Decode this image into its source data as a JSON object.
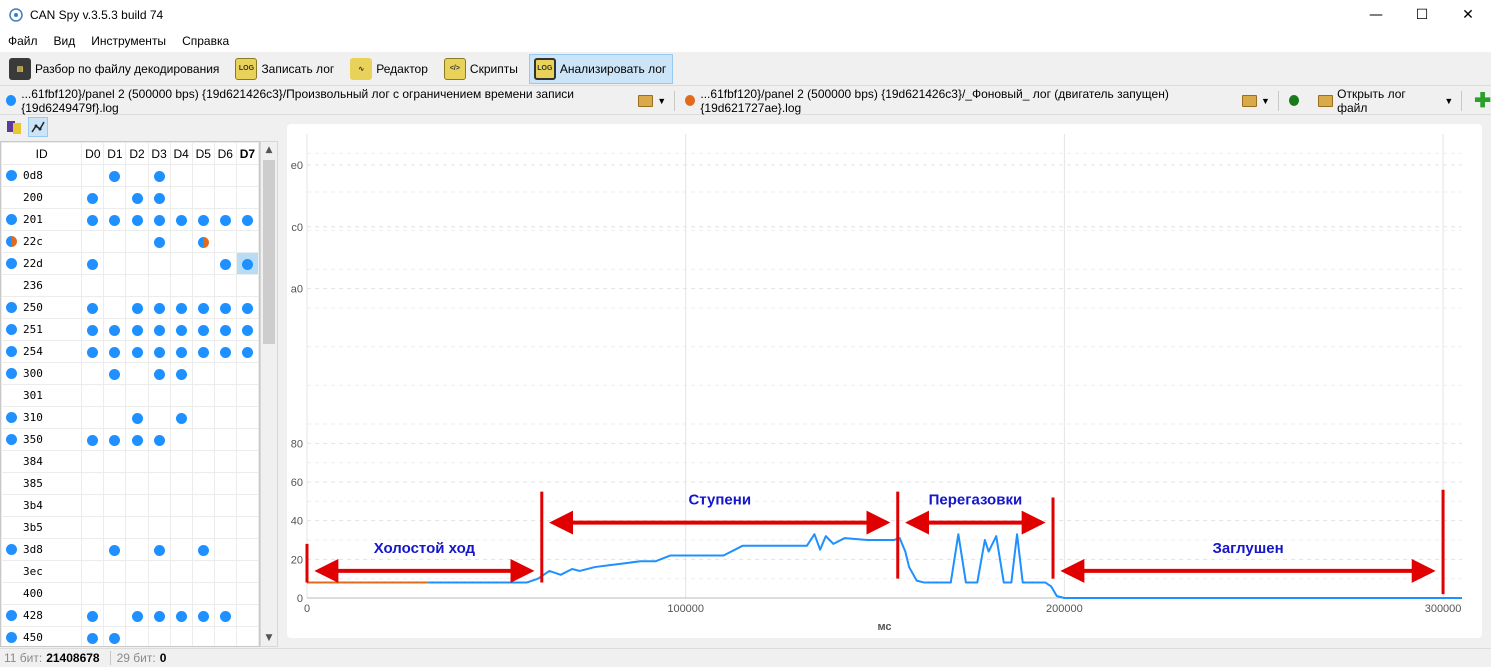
{
  "window": {
    "title": "CAN Spy v.3.5.3 build 74",
    "minimize": "—",
    "maximize": "☐",
    "close": "✕"
  },
  "menu": [
    "Файл",
    "Вид",
    "Инструменты",
    "Справка"
  ],
  "toolbar": [
    {
      "label": "Разбор по файлу декодирования",
      "icon": "decode-file-icon",
      "active": false
    },
    {
      "label": "Записать лог",
      "icon": "record-log-icon",
      "active": false
    },
    {
      "label": "Редактор",
      "icon": "editor-icon",
      "active": false
    },
    {
      "label": "Скрипты",
      "icon": "scripts-icon",
      "active": false
    },
    {
      "label": "Анализировать лог",
      "icon": "analyze-log-icon",
      "active": true
    }
  ],
  "logs": {
    "log1": {
      "label": "...61fbf120}/panel 2 (500000 bps) {19d621426c3}/Произвольный лог с ограничением времени записи {19d6249479f}.log",
      "color": "#1e90ff"
    },
    "log2": {
      "label": "...61fbf120}/panel 2 (500000 bps) {19d621426c3}/_Фоновый_ лог (двигатель запущен) {19d621727ae}.log",
      "color": "#e06b1f"
    },
    "open": {
      "label": "Открыть лог файл",
      "color": "#1a7a1a"
    }
  },
  "id_table": {
    "headers": [
      "ID",
      "D0",
      "D1",
      "D2",
      "D3",
      "D4",
      "D5",
      "D6",
      "D7"
    ],
    "rows": [
      {
        "id": "0d8",
        "status": "blue",
        "cells": [
          0,
          1,
          0,
          1,
          0,
          0,
          0,
          0
        ]
      },
      {
        "id": "200",
        "status": "none",
        "cells": [
          1,
          0,
          1,
          1,
          0,
          0,
          0,
          0
        ]
      },
      {
        "id": "201",
        "status": "blue",
        "cells": [
          1,
          1,
          1,
          1,
          1,
          1,
          1,
          1
        ]
      },
      {
        "id": "22c",
        "status": "mix",
        "cells": [
          0,
          0,
          0,
          1,
          0,
          2,
          0,
          0
        ]
      },
      {
        "id": "22d",
        "status": "blue",
        "cells": [
          1,
          0,
          0,
          0,
          0,
          0,
          1,
          3
        ]
      },
      {
        "id": "236",
        "status": "none",
        "cells": [
          0,
          0,
          0,
          0,
          0,
          0,
          0,
          0
        ]
      },
      {
        "id": "250",
        "status": "blue",
        "cells": [
          1,
          0,
          1,
          1,
          1,
          1,
          1,
          1
        ]
      },
      {
        "id": "251",
        "status": "blue",
        "cells": [
          1,
          1,
          1,
          1,
          1,
          1,
          1,
          1
        ]
      },
      {
        "id": "254",
        "status": "blue",
        "cells": [
          1,
          1,
          1,
          1,
          1,
          1,
          1,
          1
        ]
      },
      {
        "id": "300",
        "status": "blue",
        "cells": [
          0,
          1,
          0,
          1,
          1,
          0,
          0,
          0
        ]
      },
      {
        "id": "301",
        "status": "none",
        "cells": [
          0,
          0,
          0,
          0,
          0,
          0,
          0,
          0
        ]
      },
      {
        "id": "310",
        "status": "blue",
        "cells": [
          0,
          0,
          1,
          0,
          1,
          0,
          0,
          0
        ]
      },
      {
        "id": "350",
        "status": "blue",
        "cells": [
          1,
          1,
          1,
          1,
          0,
          0,
          0,
          0
        ]
      },
      {
        "id": "384",
        "status": "none",
        "cells": [
          0,
          0,
          0,
          0,
          0,
          0,
          0,
          0
        ]
      },
      {
        "id": "385",
        "status": "none",
        "cells": [
          0,
          0,
          0,
          0,
          0,
          0,
          0,
          0
        ]
      },
      {
        "id": "3b4",
        "status": "none",
        "cells": [
          0,
          0,
          0,
          0,
          0,
          0,
          0,
          0
        ]
      },
      {
        "id": "3b5",
        "status": "none",
        "cells": [
          0,
          0,
          0,
          0,
          0,
          0,
          0,
          0
        ]
      },
      {
        "id": "3d8",
        "status": "blue",
        "cells": [
          0,
          1,
          0,
          1,
          0,
          1,
          0,
          0
        ]
      },
      {
        "id": "3ec",
        "status": "none",
        "cells": [
          0,
          0,
          0,
          0,
          0,
          0,
          0,
          0
        ]
      },
      {
        "id": "400",
        "status": "none",
        "cells": [
          0,
          0,
          0,
          0,
          0,
          0,
          0,
          0
        ]
      },
      {
        "id": "428",
        "status": "blue",
        "cells": [
          1,
          0,
          1,
          1,
          1,
          1,
          1,
          0
        ]
      },
      {
        "id": "450",
        "status": "blue",
        "cells": [
          1,
          1,
          0,
          0,
          0,
          0,
          0,
          0
        ]
      }
    ]
  },
  "status": {
    "bits11_label": "11 бит:",
    "bits11_value": "21408678",
    "bits29_label": "29 бит:",
    "bits29_value": "0"
  },
  "chart_data": {
    "type": "line",
    "xlabel": "мс",
    "ylabel": "",
    "xlim": [
      0,
      305000
    ],
    "ylim": [
      0,
      240
    ],
    "xticks": [
      0,
      100000,
      200000,
      300000
    ],
    "yticks": [
      0,
      20,
      40,
      60,
      80,
      160,
      192,
      224
    ],
    "ytick_labels": [
      "0",
      "20",
      "40",
      "60",
      "80",
      "a0",
      "c0",
      "e0"
    ],
    "grid": true,
    "series": [
      {
        "color": "#e06b1f",
        "x": [
          0,
          10000,
          20000,
          32000
        ],
        "y": [
          8,
          8,
          8,
          8
        ]
      },
      {
        "color": "#1e90ff",
        "x": [
          32000,
          45000,
          58000,
          61000,
          64000,
          67000,
          70000,
          72000,
          76000,
          80000,
          84000,
          88000,
          92000,
          96000,
          100000,
          105000,
          110000,
          115000,
          120000,
          125000,
          130000,
          132000,
          134000,
          135500,
          137000,
          139000,
          142000,
          148000,
          155000,
          156500,
          158000,
          159000,
          161000,
          163000,
          166000,
          170000,
          172000,
          174000,
          177000,
          179000,
          180000,
          182000,
          184000,
          186000,
          187500,
          189000,
          191000,
          193000,
          195000,
          196500,
          198000,
          200000,
          205000,
          250000,
          300000,
          305000
        ],
        "y": [
          8,
          8,
          8,
          10,
          14,
          12,
          15,
          14,
          16,
          17,
          18,
          19,
          19,
          22,
          22,
          22,
          22,
          27,
          27,
          27,
          27,
          27,
          33,
          25,
          32,
          28,
          31,
          30,
          30,
          31,
          24,
          16,
          9,
          8,
          8,
          8,
          33,
          8,
          8,
          30,
          24,
          32,
          8,
          8,
          33,
          8,
          8,
          8,
          8,
          6,
          1,
          0,
          0,
          0,
          0,
          0
        ]
      }
    ],
    "annotations": [
      {
        "text": "Холостой ход",
        "x_from": 0,
        "x_to": 62000,
        "y": 14
      },
      {
        "text": "Ступени",
        "x_from": 62000,
        "x_to": 156000,
        "y": 39
      },
      {
        "text": "Перегазовки",
        "x_from": 156000,
        "x_to": 197000,
        "y": 39
      },
      {
        "text": "Заглушен",
        "x_from": 197000,
        "x_to": 300000,
        "y": 14
      }
    ],
    "dividers_x": [
      0,
      62000,
      156000,
      197000,
      300000
    ],
    "annotation_color": "#e00000",
    "annotation_text_color": "#1515c9"
  }
}
